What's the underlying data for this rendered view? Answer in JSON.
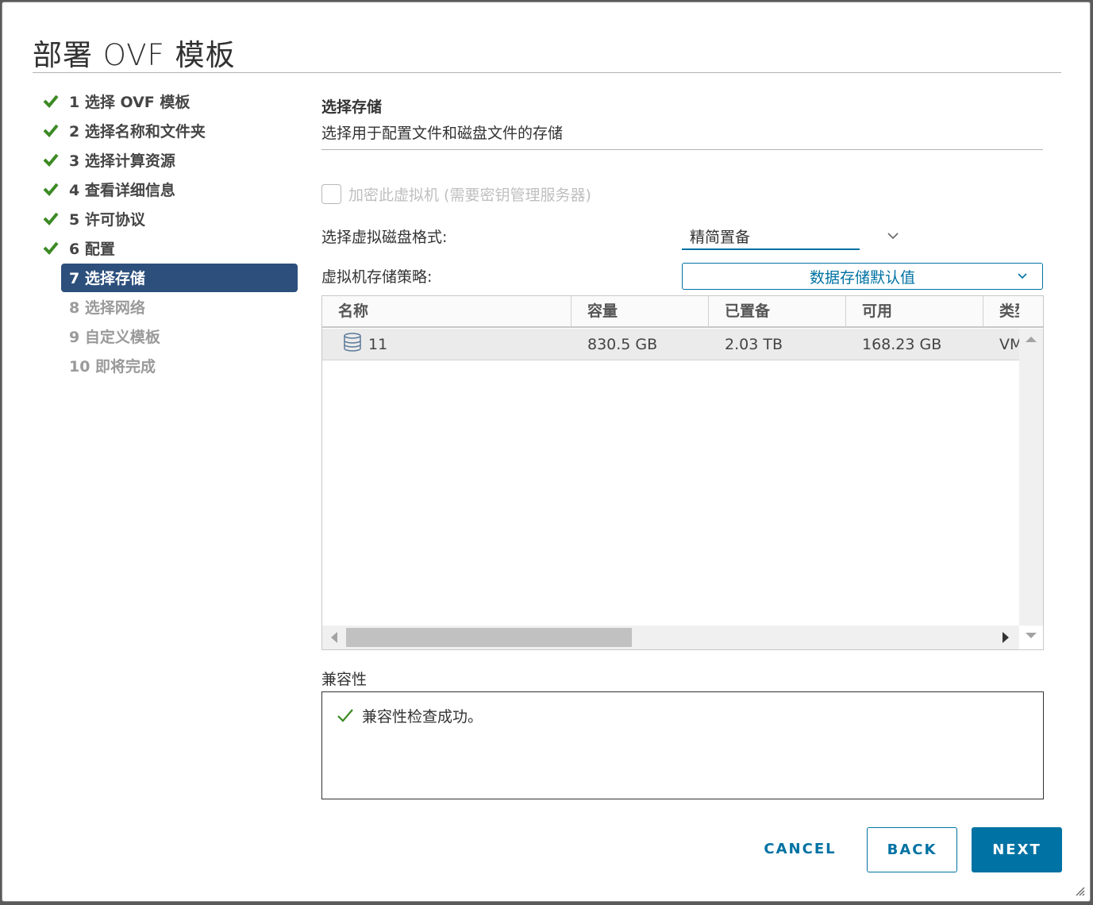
{
  "dialog": {
    "title": "部署 OVF 模板"
  },
  "steps": [
    {
      "label": "1 选择 OVF 模板",
      "state": "done"
    },
    {
      "label": "2 选择名称和文件夹",
      "state": "done"
    },
    {
      "label": "3 选择计算资源",
      "state": "done"
    },
    {
      "label": "4 查看详细信息",
      "state": "done"
    },
    {
      "label": "5 许可协议",
      "state": "done"
    },
    {
      "label": "6 配置",
      "state": "done"
    },
    {
      "label": "7 选择存储",
      "state": "active"
    },
    {
      "label": "8 选择网络",
      "state": "future"
    },
    {
      "label": "9 自定义模板",
      "state": "future"
    },
    {
      "label": "10 即将完成",
      "state": "future"
    }
  ],
  "section": {
    "title": "选择存储",
    "subtitle": "选择用于配置文件和磁盘文件的存储"
  },
  "encrypt": {
    "label": "加密此虚拟机 (需要密钥管理服务器)",
    "checked": false,
    "disabled": true
  },
  "disk_format": {
    "label": "选择虚拟磁盘格式:",
    "value": "精简置备"
  },
  "storage_policy": {
    "label": "虚拟机存储策略:",
    "value": "数据存储默认值"
  },
  "grid": {
    "columns": [
      "名称",
      "容量",
      "已置备",
      "可用",
      "类型"
    ],
    "rows": [
      {
        "name": "11",
        "capacity": "830.5 GB",
        "provisioned": "2.03 TB",
        "free": "168.23 GB",
        "type": "VMFS"
      }
    ]
  },
  "compatibility": {
    "label": "兼容性",
    "message": "兼容性检查成功。"
  },
  "buttons": {
    "cancel": "CANCEL",
    "back": "BACK",
    "next": "NEXT"
  },
  "colors": {
    "accent": "#0072a3",
    "active_step": "#2c4f7c",
    "check": "#3c8a24"
  }
}
